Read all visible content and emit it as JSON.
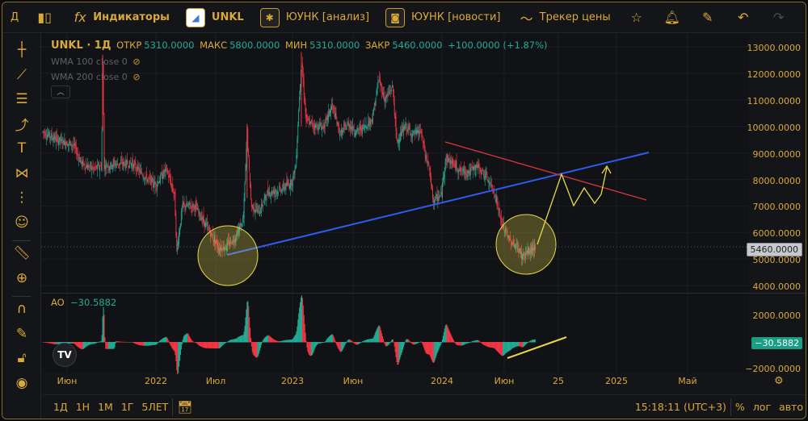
{
  "toolbar": {
    "interval": "Д",
    "indicators": "Индикаторы",
    "symbol": "UNKL",
    "analysis": "ЮУНК [анализ]",
    "news": "ЮУНК [новости]",
    "tracker": "Трекер цены"
  },
  "legend": {
    "title": "UNKL · 1Д",
    "open_label": "ОТКР",
    "open": "5310.0000",
    "high_label": "МАКС",
    "high": "5800.0000",
    "low_label": "МИН",
    "low": "5310.0000",
    "close_label": "ЗАКР",
    "close": "5460.0000",
    "change": "+100.0000 (+1.87%)",
    "wma100": "WMA 100 close 0",
    "wma200": "WMA 200 close 0"
  },
  "ao": {
    "label": "AO",
    "value": "−30.5882"
  },
  "price_axis": [
    "13000.0000",
    "12000.0000",
    "11000.0000",
    "10000.0000",
    "9000.0000",
    "8000.0000",
    "7000.0000",
    "6000.0000",
    "5000.0000",
    "4000.0000"
  ],
  "ao_axis": [
    "2000.0000",
    "−2000.0000"
  ],
  "last_price": "5460.0000",
  "ao_last": "−30.5882",
  "time_axis": [
    "Июн",
    "2022",
    "Июл",
    "2023",
    "Июн",
    "2024",
    "Июн",
    "25",
    "2025",
    "Май"
  ],
  "bottom": {
    "ranges": [
      "1Д",
      "1Н",
      "1М",
      "1Г",
      "5ЛЕТ"
    ],
    "clock": "15:18:11 (UTC+3)",
    "percent": "%",
    "log": "лог",
    "auto": "авто"
  },
  "colors": {
    "up": "#22ab94",
    "down": "#f23645",
    "accent": "#d9a93a",
    "support": "#2f5cf0",
    "resistance": "#d9343f",
    "marker": "#e8d84a"
  },
  "chart_data": {
    "type": "candlestick",
    "symbol": "UNKL",
    "timeframe": "1D",
    "ylim": [
      4000,
      13000
    ],
    "path_days_price": [
      [
        0,
        9800
      ],
      [
        39,
        9500
      ],
      [
        82,
        9300
      ],
      [
        104,
        8600
      ],
      [
        136,
        8400
      ],
      [
        157,
        8500
      ],
      [
        160,
        12400
      ],
      [
        164,
        8500
      ],
      [
        194,
        8600
      ],
      [
        238,
        8600
      ],
      [
        281,
        8000
      ],
      [
        302,
        7800
      ],
      [
        330,
        8400
      ],
      [
        352,
        7400
      ],
      [
        358,
        5300
      ],
      [
        373,
        7000
      ],
      [
        406,
        7000
      ],
      [
        439,
        6200
      ],
      [
        471,
        5400
      ],
      [
        492,
        5500
      ],
      [
        514,
        5800
      ],
      [
        536,
        6500
      ],
      [
        546,
        9800
      ],
      [
        557,
        7000
      ],
      [
        579,
        6800
      ],
      [
        600,
        7500
      ],
      [
        633,
        7600
      ],
      [
        665,
        7900
      ],
      [
        676,
        8500
      ],
      [
        691,
        12500
      ],
      [
        704,
        10200
      ],
      [
        730,
        10000
      ],
      [
        752,
        10000
      ],
      [
        773,
        10800
      ],
      [
        795,
        9700
      ],
      [
        816,
        10100
      ],
      [
        838,
        9800
      ],
      [
        860,
        10000
      ],
      [
        881,
        10300
      ],
      [
        898,
        11800
      ],
      [
        914,
        11000
      ],
      [
        935,
        11500
      ],
      [
        946,
        9400
      ],
      [
        968,
        10000
      ],
      [
        989,
        9700
      ],
      [
        1011,
        9800
      ],
      [
        1022,
        8900
      ],
      [
        1032,
        8500
      ],
      [
        1043,
        7200
      ],
      [
        1065,
        7400
      ],
      [
        1076,
        8800
      ],
      [
        1097,
        8600
      ],
      [
        1119,
        8300
      ],
      [
        1140,
        8300
      ],
      [
        1162,
        8500
      ],
      [
        1184,
        8100
      ],
      [
        1205,
        7600
      ],
      [
        1216,
        7000
      ],
      [
        1227,
        6300
      ],
      [
        1238,
        6000
      ],
      [
        1248,
        5700
      ],
      [
        1270,
        5400
      ],
      [
        1281,
        5100
      ],
      [
        1302,
        5300
      ],
      [
        1317,
        5460
      ]
    ]
  }
}
